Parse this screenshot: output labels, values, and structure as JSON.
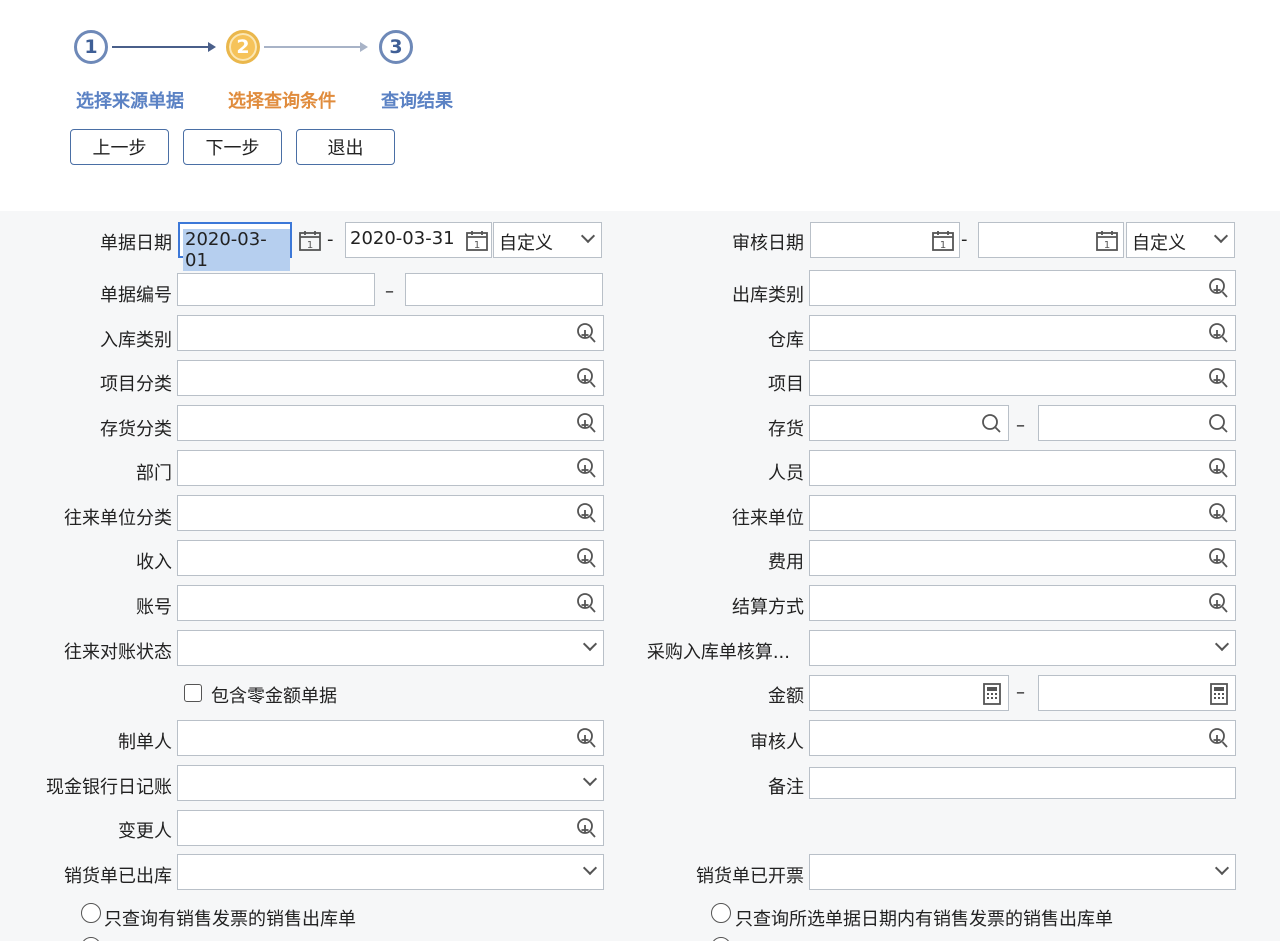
{
  "wizard": {
    "steps": [
      {
        "num": "1",
        "label": "选择来源单据"
      },
      {
        "num": "2",
        "label": "选择查询条件"
      },
      {
        "num": "3",
        "label": "查询结果"
      }
    ],
    "buttons": {
      "prev": "上一步",
      "next": "下一步",
      "exit": "退出"
    }
  },
  "form": {
    "doc_date": {
      "label": "单据日期",
      "from": "2020-03-01",
      "to": "2020-03-31",
      "range": "自定义"
    },
    "audit_date": {
      "label": "审核日期",
      "from": "",
      "to": "",
      "range": "自定义"
    },
    "doc_no": {
      "label": "单据编号"
    },
    "out_type": {
      "label": "出库类别"
    },
    "in_type": {
      "label": "入库类别"
    },
    "warehouse": {
      "label": "仓库"
    },
    "project_cat": {
      "label": "项目分类"
    },
    "project": {
      "label": "项目"
    },
    "stock_cat": {
      "label": "存货分类"
    },
    "stock": {
      "label": "存货"
    },
    "dept": {
      "label": "部门"
    },
    "person": {
      "label": "人员"
    },
    "partner_cat": {
      "label": "往来单位分类"
    },
    "partner": {
      "label": "往来单位"
    },
    "income": {
      "label": "收入"
    },
    "expense": {
      "label": "费用"
    },
    "account": {
      "label": "账号"
    },
    "settle": {
      "label": "结算方式"
    },
    "reconcile": {
      "label": "往来对账状态"
    },
    "purchase_acc": {
      "label": "采购入库单核算..."
    },
    "zero_amount": {
      "label": "包含零金额单据"
    },
    "amount": {
      "label": "金额"
    },
    "maker": {
      "label": "制单人"
    },
    "auditor": {
      "label": "审核人"
    },
    "cash_journal": {
      "label": "现金银行日记账"
    },
    "remark": {
      "label": "备注"
    },
    "changer": {
      "label": "变更人"
    },
    "sales_out": {
      "label": "销货单已出库"
    },
    "sales_invoiced": {
      "label": "销货单已开票"
    },
    "radio_left": "只查询有销售发票的销售出库单",
    "radio_right": "只查询所选单据日期内有销售发票的销售出库单"
  },
  "colors": {
    "accent": "#3c78d8",
    "step_active": "#f6c35a",
    "step_label": "#5b82c4",
    "step_label_active": "#e08c3d"
  }
}
